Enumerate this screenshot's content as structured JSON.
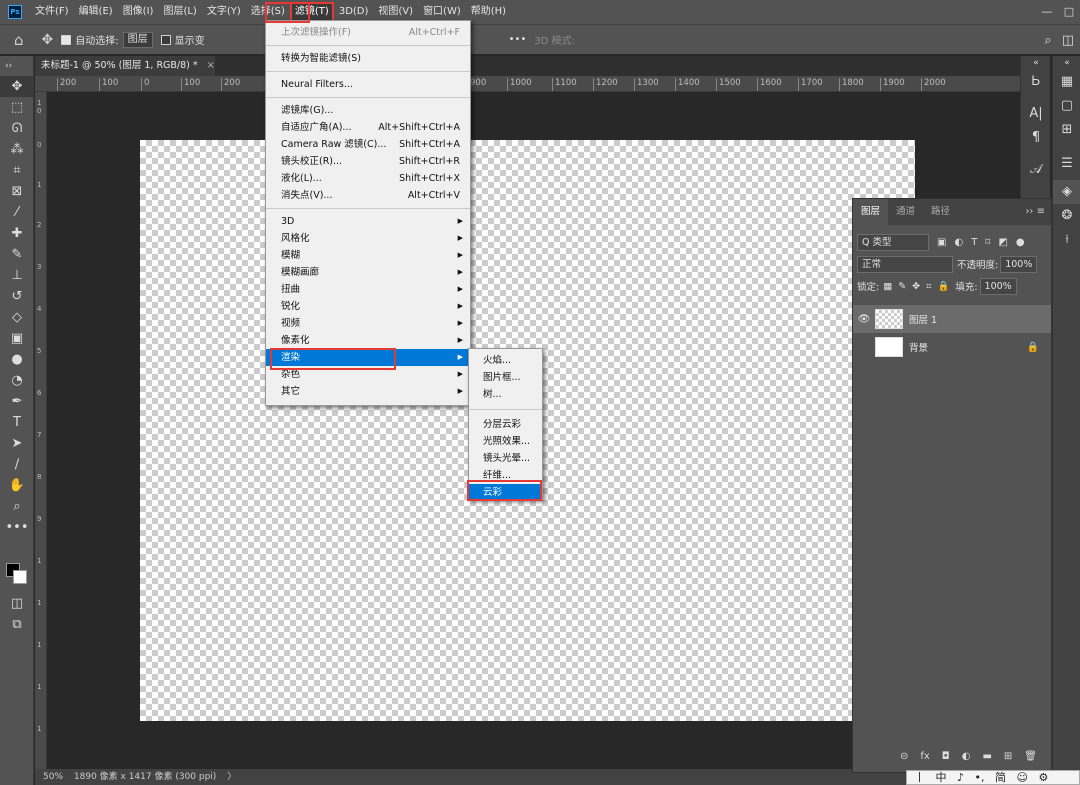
{
  "menubar": {
    "logo": "Ps",
    "items": [
      "文件(F)",
      "编辑(E)",
      "图像(I)",
      "图层(L)",
      "文字(Y)",
      "选择(S)",
      "滤镜(T)",
      "3D(D)",
      "视图(V)",
      "窗口(W)",
      "帮助(H)"
    ],
    "active_item": "滤镜(T)",
    "window_controls": {
      "minimize": "—",
      "restore": "□"
    }
  },
  "options_bar": {
    "home": "⌂",
    "move": "✥",
    "auto_select_label": "自动选择:",
    "auto_select_value": "图层",
    "show_transform_label": "显示变",
    "more": "•••",
    "mode_label": "3D 模式:",
    "search_icon": "⌕",
    "window_icon": "◫"
  },
  "document": {
    "tab_title": "未标题-1 @ 50% (图层 1, RGB/8) *",
    "close": "×",
    "ruler_labels": [
      "200",
      "100",
      "0",
      "100",
      "200",
      "900",
      "1000",
      "1100",
      "1200",
      "1300",
      "1400",
      "1500",
      "1600",
      "1700",
      "1800",
      "1900",
      "2000"
    ],
    "vruler_labels": [
      "1",
      "0",
      "0",
      "1",
      "2",
      "3",
      "4",
      "5",
      "6",
      "7",
      "8",
      "9",
      "1",
      "1",
      "1",
      "1",
      "1"
    ]
  },
  "status": {
    "zoom": "50%",
    "doc_size": "1890 像素 x 1417 像素 (300 ppi)",
    "arrow": "〉"
  },
  "filter_menu": {
    "last_filter": "上次滤镜操作(F)",
    "last_filter_shortcut": "Alt+Ctrl+F",
    "convert_smart": "转换为智能滤镜(S)",
    "neural": "Neural Filters...",
    "gallery": "滤镜库(G)...",
    "adaptive_wide": "自适应广角(A)...",
    "adaptive_wide_shortcut": "Alt+Shift+Ctrl+A",
    "camera_raw": "Camera Raw 滤镜(C)...",
    "camera_raw_shortcut": "Shift+Ctrl+A",
    "lens_correction": "镜头校正(R)...",
    "lens_correction_shortcut": "Shift+Ctrl+R",
    "liquify": "液化(L)...",
    "liquify_shortcut": "Shift+Ctrl+X",
    "vanishing": "消失点(V)...",
    "vanishing_shortcut": "Alt+Ctrl+V",
    "submenus": [
      "3D",
      "风格化",
      "模糊",
      "模糊画廊",
      "扭曲",
      "锐化",
      "视频",
      "像素化",
      "渲染",
      "杂色",
      "其它"
    ],
    "highlighted": "渲染"
  },
  "render_menu": {
    "items_top": [
      "火焰...",
      "图片框...",
      "树..."
    ],
    "items_bottom": [
      "分层云彩",
      "光照效果...",
      "镜头光晕...",
      "纤维...",
      "云彩"
    ],
    "highlighted": "云彩"
  },
  "layers_panel": {
    "tabs": [
      "图层",
      "通道",
      "路径"
    ],
    "active_tab": "图层",
    "menu": "›› ≡",
    "filter_kind": "Q 类型",
    "blend_mode": "正常",
    "opacity_label": "不透明度:",
    "opacity_value": "100%",
    "lock_label": "锁定:",
    "fill_label": "填充:",
    "fill_value": "100%",
    "layers": [
      {
        "name": "图层 1",
        "visible": true,
        "selected": true
      },
      {
        "name": "背景",
        "visible": false,
        "locked": true
      }
    ],
    "footer_icons": [
      "⊝",
      "fx",
      "◘",
      "◐",
      "▬",
      "⊞",
      "🗑"
    ]
  },
  "ime_bar": [
    "丨",
    "中",
    "♪",
    "•,",
    "简",
    "☺",
    "⚙"
  ],
  "colors": {
    "accent_red": "#e53935",
    "highlight_blue": "#0078d7",
    "panel": "#535353",
    "workspace": "#282828"
  }
}
